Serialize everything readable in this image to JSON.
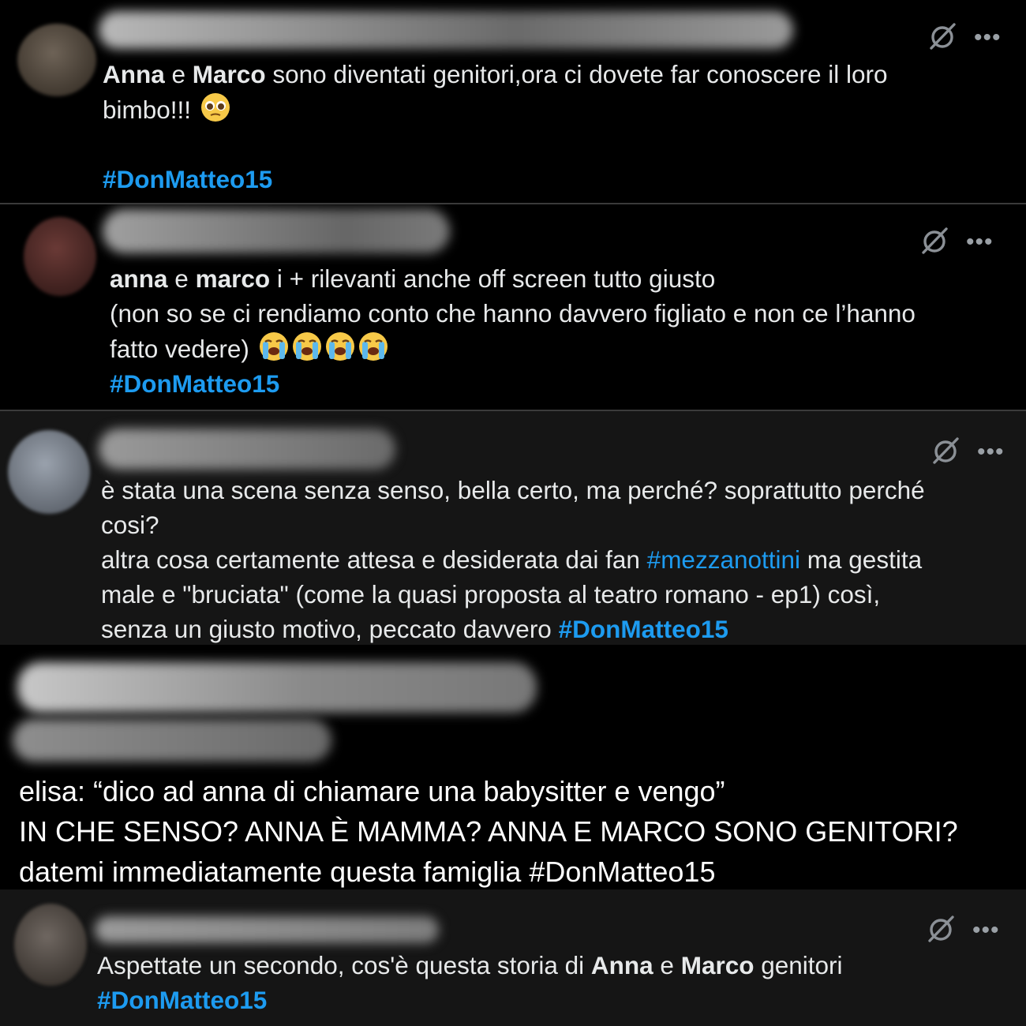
{
  "icons": {
    "grok": "grok-slash-icon",
    "more": "more-dots-icon",
    "pleading": "pleading-face-icon",
    "crying": "loudly-crying-face-icon"
  },
  "colors": {
    "background": "#000000",
    "hashtag": "#1d9bf0",
    "text": "#e7e9ea"
  },
  "more_label": "•••",
  "tweets": [
    {
      "name1": "Anna",
      "and1": " e ",
      "name2": "Marco",
      "text1": " sono diventati genitori,ora ci dovete far conoscere il loro",
      "text2": "bimbo!!! ",
      "hashtag": "#DonMatteo15"
    },
    {
      "name1": "anna",
      "and1": " e ",
      "name2": "marco",
      "line1": " i + rilevanti anche off screen tutto giusto",
      "line2": "(non so se ci rendiamo conto che hanno davvero figliato e non ce l’hanno",
      "line3": "fatto vedere) ",
      "hashtag": "#DonMatteo15"
    },
    {
      "line1": "è stata una scena senza senso, bella certo, ma perché? soprattutto perché",
      "line2": "cosi?",
      "line3a": "altra cosa certamente attesa e desiderata dai fan ",
      "hashtag_inline": "#mezzanottini",
      "line3b": " ma gestita",
      "line4": "male e \"bruciata\" (come la quasi proposta al teatro romano - ep1) così,",
      "line5": "senza un giusto motivo, peccato davvero ",
      "hashtag": "#DonMatteo15"
    },
    {
      "line1": "elisa: “dico ad anna di chiamare una babysitter e vengo”",
      "line2": "IN CHE SENSO? ANNA È MAMMA? ANNA E MARCO SONO GENITORI?",
      "line3": "datemi immediatamente questa famiglia #DonMatteo15"
    },
    {
      "text1": "Aspettate un secondo, cos'è questa storia di ",
      "name1": "Anna",
      "and1": " e ",
      "name2": "Marco",
      "text2": " genitori",
      "hashtag": "#DonMatteo15"
    }
  ]
}
